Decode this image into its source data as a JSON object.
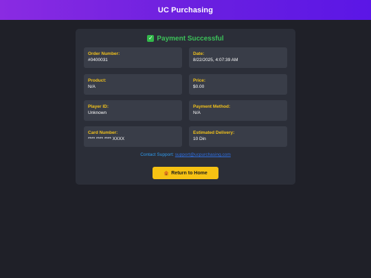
{
  "app": {
    "title": "UC Purchasing"
  },
  "status": {
    "icon": "check-icon",
    "text": "Payment Successful",
    "color": "#3cc25a"
  },
  "fields": {
    "order_number": {
      "label": "Order Number:",
      "value": "#0400031"
    },
    "date": {
      "label": "Date:",
      "value": "8/22/2025, 4:07:39 AM"
    },
    "product": {
      "label": "Product:",
      "value": "N/A"
    },
    "price": {
      "label": "Price:",
      "value": "$0.00"
    },
    "player_id": {
      "label": "Player ID:",
      "value": "Unknown"
    },
    "payment_method": {
      "label": "Payment Method:",
      "value": "N/A"
    },
    "card_number": {
      "label": "Card Number:",
      "value": "**** **** **** XXXX"
    },
    "estimated_delivery": {
      "label": "Estimated Delivery:",
      "value": "10 Din"
    }
  },
  "support": {
    "prefix": "Contact Support: ",
    "link_text": "support@ucpurchasing.com"
  },
  "return_button": {
    "icon": "home-icon",
    "label": "Return to Home"
  },
  "colors": {
    "accent": "#f6c213",
    "header_start": "#8a2be2",
    "header_end": "#5b16e6",
    "label": "#f2c21b"
  }
}
